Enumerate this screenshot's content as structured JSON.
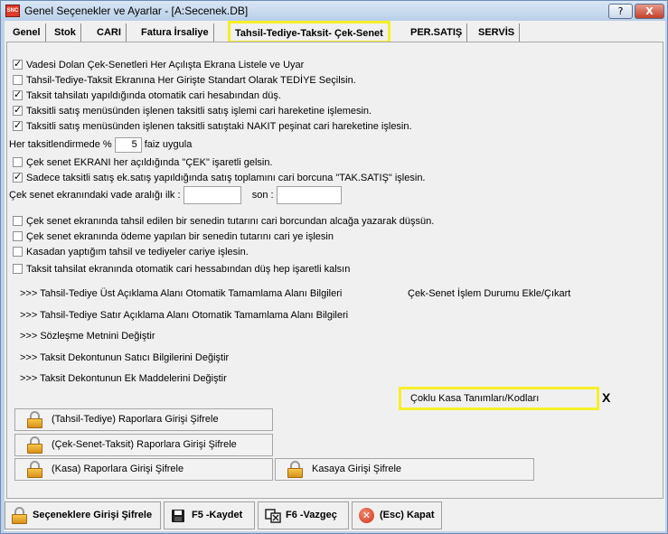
{
  "window": {
    "app_icon_text": "SNC",
    "title": "Genel Seçenekler ve Ayarlar - [A:Secenek.DB]",
    "help_label": "?",
    "close_label": "X"
  },
  "tabs": [
    {
      "label": "Genel"
    },
    {
      "label": "Stok"
    },
    {
      "label": "CARI"
    },
    {
      "label": "Fatura İrsaliye"
    },
    {
      "label": "Tahsil-Tediye-Taksit- Çek-Senet"
    },
    {
      "label": "PER.SATIŞ"
    },
    {
      "label": "SERVİS"
    }
  ],
  "options": {
    "opt1": {
      "label": "Vadesi Dolan Çek-Senetleri Her Açılışta Ekrana Listele ve Uyar",
      "checked": true
    },
    "opt2": {
      "label": "Tahsil-Tediye-Taksit Ekranına Her Girişte Standart Olarak TEDİYE Seçilsin.",
      "checked": false
    },
    "opt3": {
      "label": "Taksit tahsilatı yapıldığında otomatik cari hesabından düş.",
      "checked": true
    },
    "opt4": {
      "label": "Taksitli satış menüsünden işlenen taksitli satış işlemi cari hareketine işlemesin.",
      "checked": true
    },
    "opt5": {
      "label": "Taksitli satış menüsünden işlenen taksitli satıştaki NAKIT peşinat cari hareketine işlesin.",
      "checked": true
    },
    "faiz_prefix": "Her taksitlendirmede %",
    "faiz_value": "5",
    "faiz_suffix": "faiz uygula",
    "opt6": {
      "label": "Çek senet EKRANI her açıldığında \"ÇEK\" işaretli gelsin.",
      "checked": false
    },
    "opt7": {
      "label": "Sadece taksitli satış ek.satış yapıldığında satış toplamını cari borcuna \"TAK.SATIŞ\" işlesin.",
      "checked": true
    },
    "vade_prefix": "Çek senet ekranındaki vade aralığı ilk :",
    "vade_son": "son :",
    "opt8": {
      "label": "Çek senet ekranında tahsil edilen bir senedin tutarını cari borcundan alcağa yazarak düşsün.",
      "checked": false
    },
    "opt9": {
      "label": "Çek senet ekranında ödeme yapılan bir senedin tutarını cari ye işlesin",
      "checked": false
    },
    "opt10": {
      "label": "Kasadan yaptığım tahsil ve tediyeler cariye işlesin.",
      "checked": false
    },
    "opt11": {
      "label": "Taksit tahsilat ekranında otomatik cari hessabından düş hep işaretli kalsın",
      "checked": false
    }
  },
  "links": {
    "ust_aciklama": ">>> Tahsil-Tediye Üst Açıklama Alanı Otomatik Tamamlama Alanı Bilgileri",
    "cek_senet_durum": "Çek-Senet İşlem Durumu Ekle/Çıkart",
    "satir_aciklama": ">>> Tahsil-Tediye Satır Açıklama Alanı Otomatik Tamamlama Alanı Bilgileri",
    "sozlesme": ">>> Sözleşme Metnini Değiştir",
    "satici": ">>> Taksit Dekontunun Satıcı Bilgilerini Değiştir",
    "ek_madde": ">>> Taksit Dekontunun Ek Maddelerini Değiştir",
    "coklu_kasa": "Çoklu Kasa Tanımları/Kodları",
    "x_mark": "X"
  },
  "lock_buttons": {
    "tahsil": "(Tahsil-Tediye) Raporlara Girişi Şifrele",
    "cek": "(Çek-Senet-Taksit) Raporlara Girişi Şifrele",
    "kasa_rapor": "(Kasa) Raporlara Girişi Şifrele",
    "kasa_giris": "Kasaya Girişi Şifrele"
  },
  "bottom": {
    "secenek_sifre": "Seçeneklere Girişi Şifrele",
    "kaydet": "F5 -Kaydet",
    "vazgec": "F6 -Vazgeç",
    "kapat": "(Esc) Kapat"
  },
  "colors": {
    "highlight": "#f6ef2a",
    "title_bg": "#bfd2e8",
    "close_btn": "#c4402c"
  }
}
